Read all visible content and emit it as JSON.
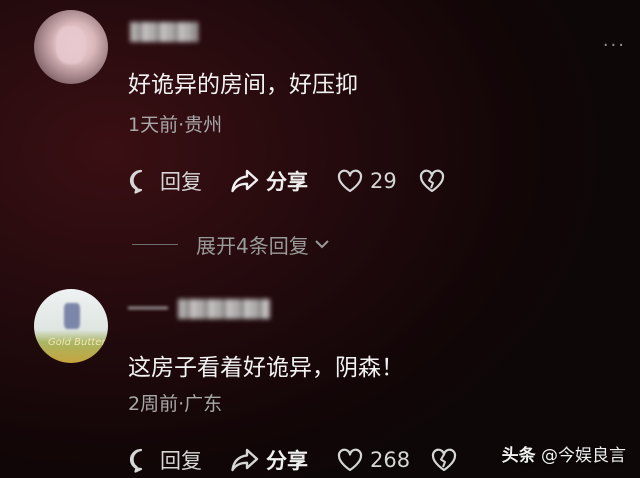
{
  "comments": [
    {
      "text": "好诡异的房间，好压抑",
      "meta": "1天前·贵州",
      "reply_label": "回复",
      "share_label": "分享",
      "likes": "29",
      "avatar_icon": "user-avatar-photo"
    },
    {
      "text": "这房子看着好诡异，阴森！",
      "meta": "2周前·广东",
      "reply_label": "回复",
      "share_label": "分享",
      "likes": "268",
      "avatar_icon": "user-avatar-landscape",
      "avatar_script": "Gold Butter"
    }
  ],
  "expand_replies": "展开4条回复",
  "more_menu": "···",
  "watermark": {
    "brand": "头条",
    "handle": "@今娱良言"
  },
  "colors": {
    "background_dark": "#120607",
    "background_red": "#3a0f13",
    "text_primary": "#f2f2f2",
    "text_secondary": "#a8a8a8"
  }
}
